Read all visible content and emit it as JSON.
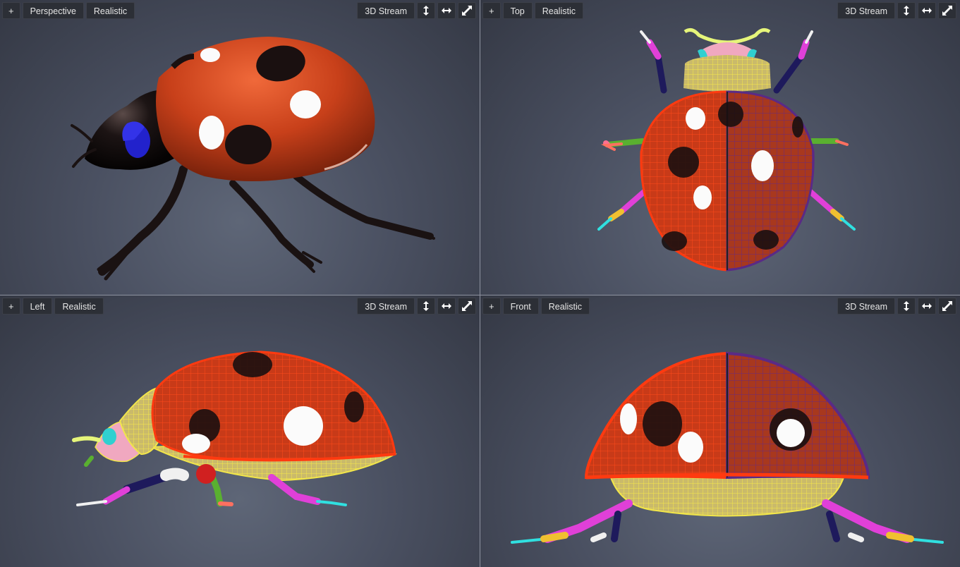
{
  "viewports": [
    {
      "id": "tl",
      "plus": "+",
      "view": "Perspective",
      "shading": "Realistic",
      "stream": "3D Stream"
    },
    {
      "id": "tr",
      "plus": "+",
      "view": "Top",
      "shading": "Realistic",
      "stream": "3D Stream"
    },
    {
      "id": "bl",
      "plus": "+",
      "view": "Left",
      "shading": "Realistic",
      "stream": "3D Stream"
    },
    {
      "id": "br",
      "plus": "+",
      "view": "Front",
      "shading": "Realistic",
      "stream": "3D Stream"
    }
  ],
  "icons": {
    "vertical": "arrows-vertical-icon",
    "horizontal": "arrows-horizontal-icon",
    "maximize": "maximize-icon"
  },
  "colors": {
    "shell_red": "#d8431c",
    "spot_black": "#1a1010",
    "wire_yellow": "#f2e64a",
    "wire_red": "#ff3a10",
    "wire_purple": "#5a2a86",
    "leg_magenta": "#e040d8",
    "leg_cyan": "#30e0e0"
  }
}
